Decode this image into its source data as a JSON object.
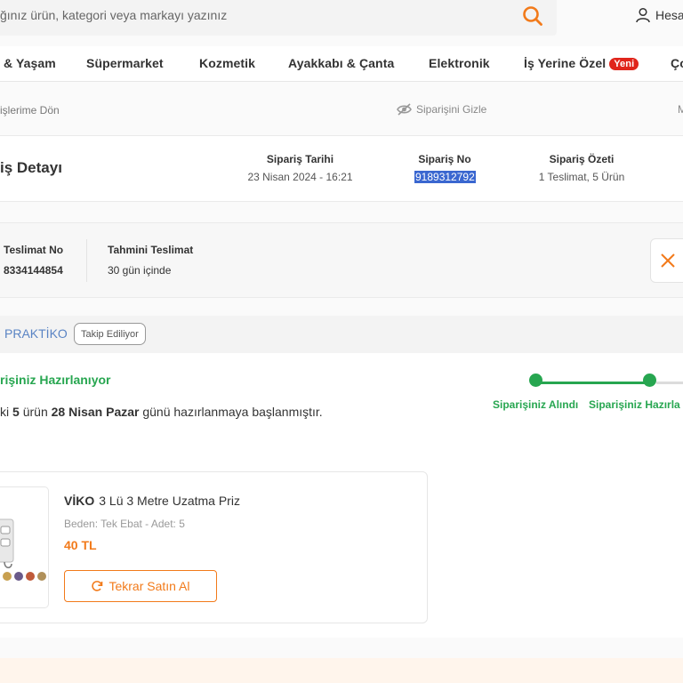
{
  "header": {
    "search_placeholder": "ğınız ürün, kategori veya markayı yazınız",
    "account_label": "Hesa"
  },
  "nav": {
    "items": [
      "& Yaşam",
      "Süpermarket",
      "Kozmetik",
      "Ayakkabı & Çanta",
      "Elektronik",
      "İş Yerine Özel",
      "Ço"
    ],
    "new_badge": "Yeni"
  },
  "back_row": {
    "back_label": "işlerime Dön",
    "hide_label": "Siparişini Gizle",
    "right_cut": "M"
  },
  "order": {
    "title": "iş Detayı",
    "date_label": "Sipariş Tarihi",
    "date_value": "23 Nisan 2024 - 16:21",
    "no_label": "Sipariş No",
    "no_value": "9189312792",
    "summary_label": "Sipariş Özeti",
    "summary_value": "1 Teslimat, 5 Ürün"
  },
  "shipment": {
    "no_label": "Teslimat No",
    "no_value": "8334144854",
    "eta_label": "Tahmini Teslimat",
    "eta_value": "30 gün içinde"
  },
  "seller": {
    "name": "PRAKTİKO",
    "follow_label": "Takip Ediliyor"
  },
  "status": {
    "title": "rişiniz Hazırlanıyor",
    "desc_prefix": "ki",
    "desc_count": "5",
    "desc_mid": "ürün",
    "desc_date": "28 Nisan Pazar",
    "desc_suffix": "günü hazırlanmaya başlanmıştır.",
    "steps": [
      "Siparişiniz Alındı",
      "Siparişiniz Hazırla"
    ]
  },
  "product": {
    "brand": "VİKO",
    "name": "3 Lü 3 Metre Uzatma Priz",
    "meta": "Beden: Tek Ebat - Adet: 5",
    "price": "40 TL",
    "rebuy_label": "Tekrar Satın Al"
  },
  "colors": {
    "accent": "#f27a1a",
    "success": "#27a650",
    "selection": "#3a67d0",
    "badge": "#e0251b"
  }
}
